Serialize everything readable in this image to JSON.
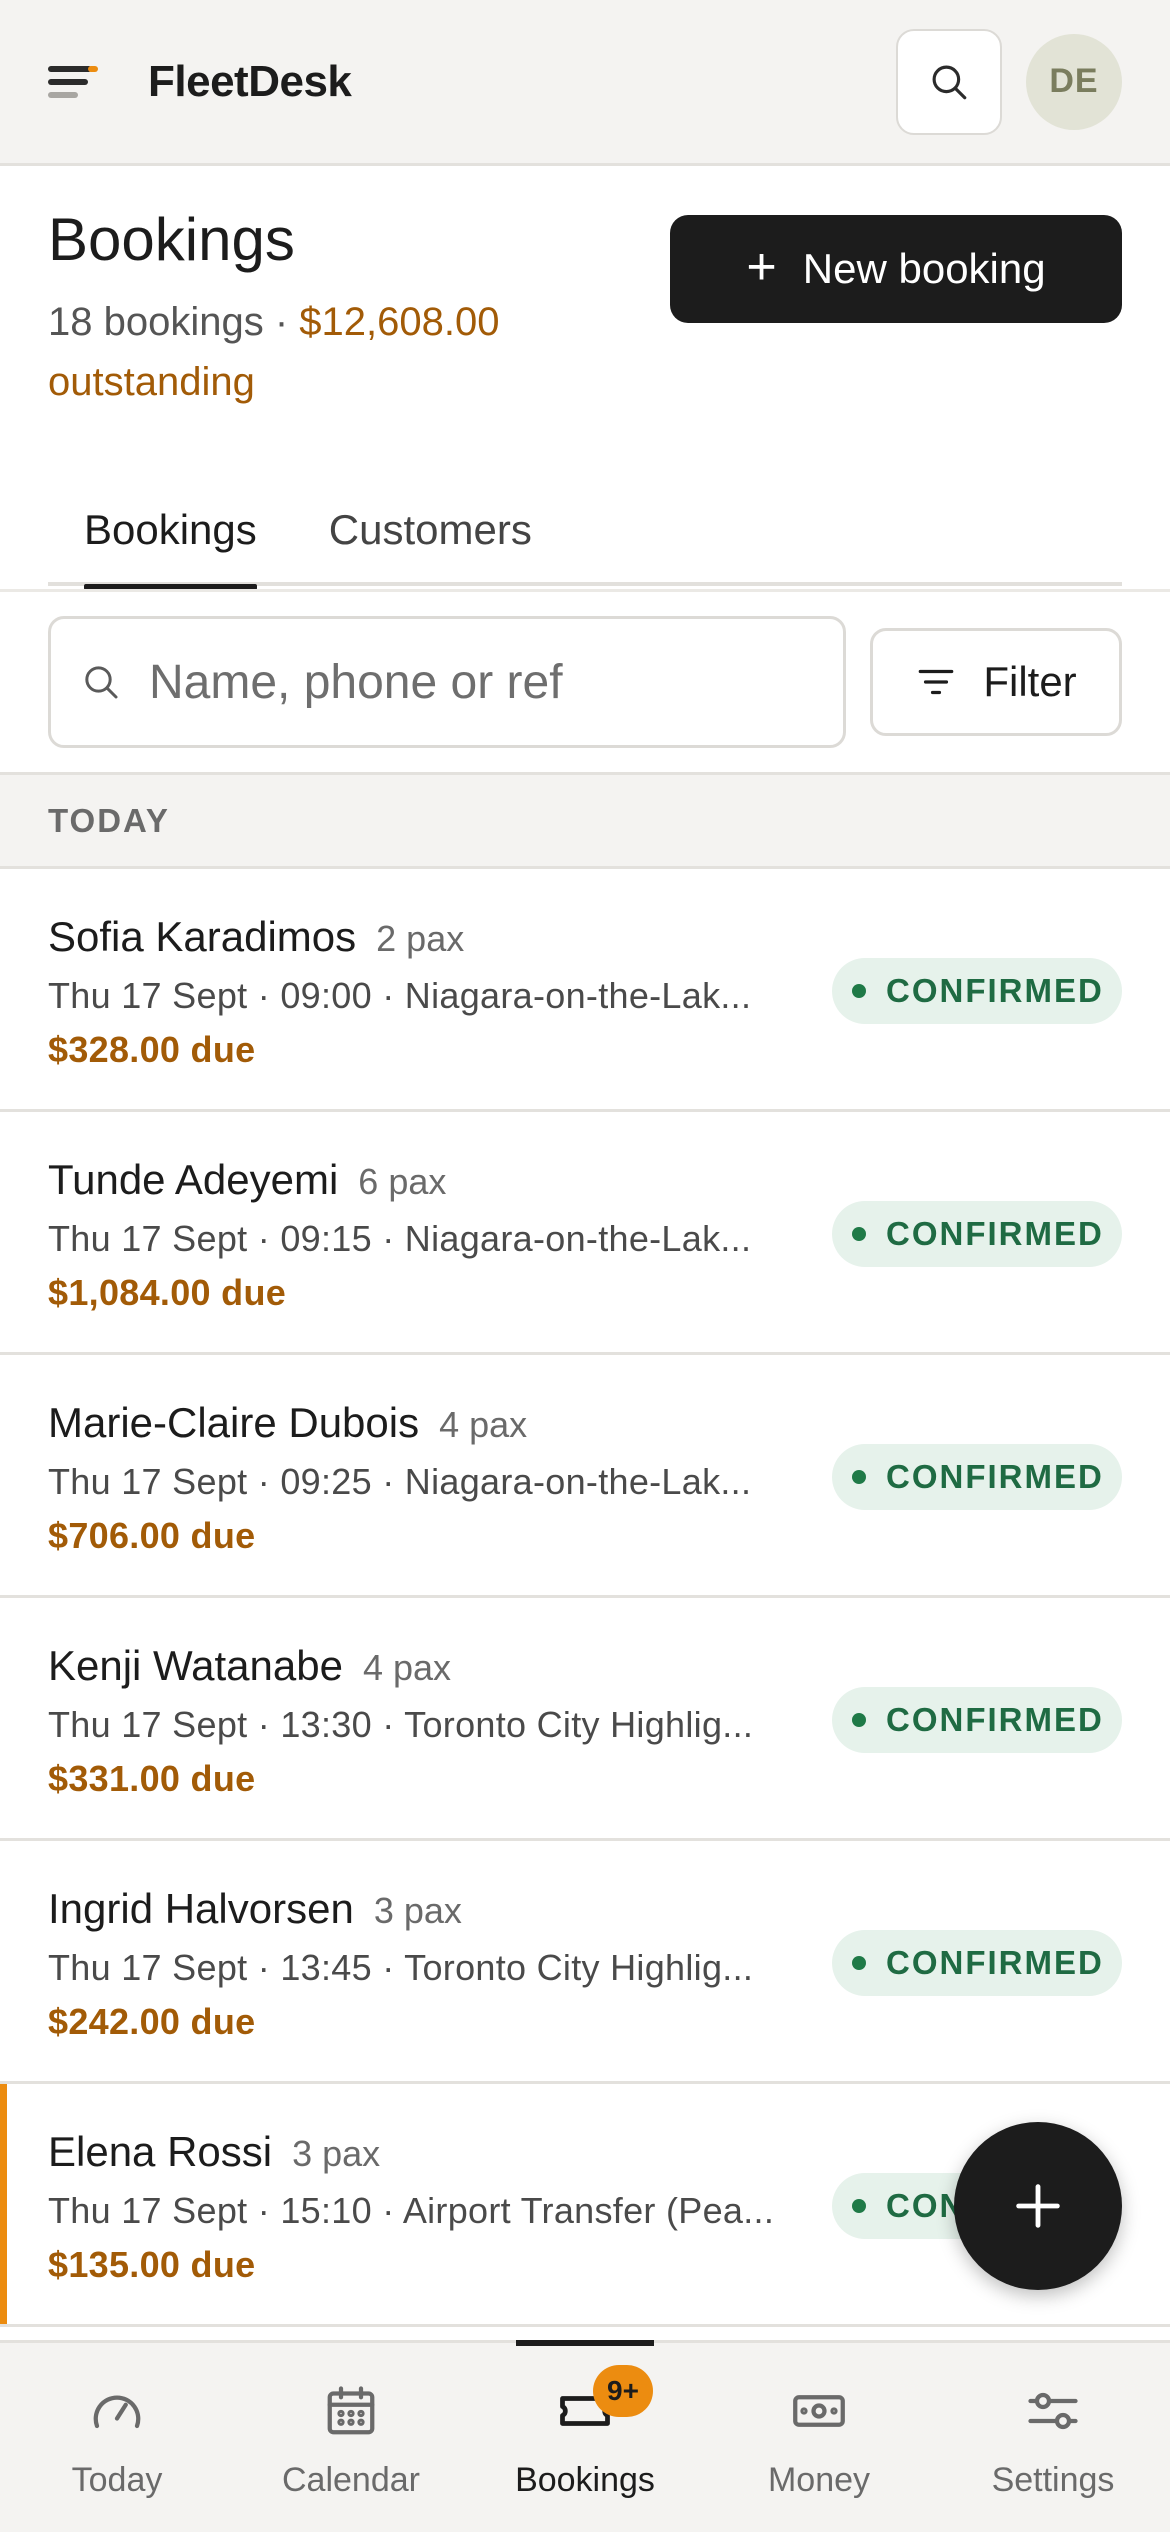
{
  "header": {
    "brand": "FleetDesk",
    "avatar_initials": "DE"
  },
  "page": {
    "title": "Bookings",
    "count_text": "18 bookings · ",
    "outstanding_text": "$12,608.00 outstanding",
    "new_booking_label": "New booking"
  },
  "tabs": [
    {
      "label": "Bookings",
      "active": true
    },
    {
      "label": "Customers",
      "active": false
    }
  ],
  "search": {
    "placeholder": "Name, phone or ref",
    "value": ""
  },
  "filter_label": "Filter",
  "section_label": "TODAY",
  "bookings": [
    {
      "name": "Sofia Karadimos",
      "pax": "2 pax",
      "meta": "Thu 17 Sept · 09:00 · Niagara-on-the-Lak...",
      "due": "$328.00 due",
      "status": "CONFIRMED",
      "flagged": false
    },
    {
      "name": "Tunde Adeyemi",
      "pax": "6 pax",
      "meta": "Thu 17 Sept · 09:15 · Niagara-on-the-Lak...",
      "due": "$1,084.00 due",
      "status": "CONFIRMED",
      "flagged": false
    },
    {
      "name": "Marie-Claire Dubois",
      "pax": "4 pax",
      "meta": "Thu 17 Sept · 09:25 · Niagara-on-the-Lak...",
      "due": "$706.00 due",
      "status": "CONFIRMED",
      "flagged": false
    },
    {
      "name": "Kenji Watanabe",
      "pax": "4 pax",
      "meta": "Thu 17 Sept · 13:30 · Toronto City Highlig...",
      "due": "$331.00 due",
      "status": "CONFIRMED",
      "flagged": false
    },
    {
      "name": "Ingrid Halvorsen",
      "pax": "3 pax",
      "meta": "Thu 17 Sept · 13:45 · Toronto City Highlig...",
      "due": "$242.00 due",
      "status": "CONFIRMED",
      "flagged": false
    },
    {
      "name": "Elena Rossi",
      "pax": "3 pax",
      "meta": "Thu 17 Sept · 15:10 · Airport Transfer (Pea...",
      "due": "$135.00 due",
      "status": "CONFIRMED",
      "flagged": true
    }
  ],
  "nav": [
    {
      "label": "Today",
      "icon": "gauge-icon",
      "active": false
    },
    {
      "label": "Calendar",
      "icon": "calendar-icon",
      "active": false
    },
    {
      "label": "Bookings",
      "icon": "ticket-icon",
      "active": true,
      "badge": "9+"
    },
    {
      "label": "Money",
      "icon": "banknote-icon",
      "active": false
    },
    {
      "label": "Settings",
      "icon": "sliders-icon",
      "active": false
    }
  ],
  "colors": {
    "accent_amount": "#a25b07",
    "badge_bg": "#e6f2eb",
    "badge_text": "#1f6b43",
    "flag": "#ec8c10",
    "primary": "#1c1c1c"
  }
}
